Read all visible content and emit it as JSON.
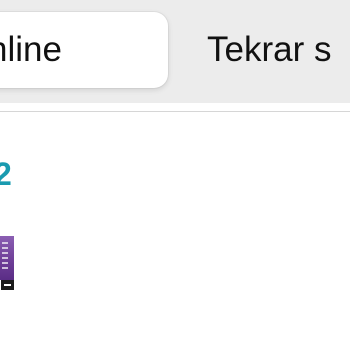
{
  "tabs": {
    "online_label": "nline",
    "replay_label": "Tekrar s"
  },
  "content": {
    "number": "2"
  },
  "colors": {
    "segment_bg": "#ececec",
    "active_segment": "#ffffff",
    "accent": "#1a9bb0",
    "thumbnail": "#6f3f98"
  },
  "icons": {
    "thumbnail": "video-thumbnail-icon"
  }
}
